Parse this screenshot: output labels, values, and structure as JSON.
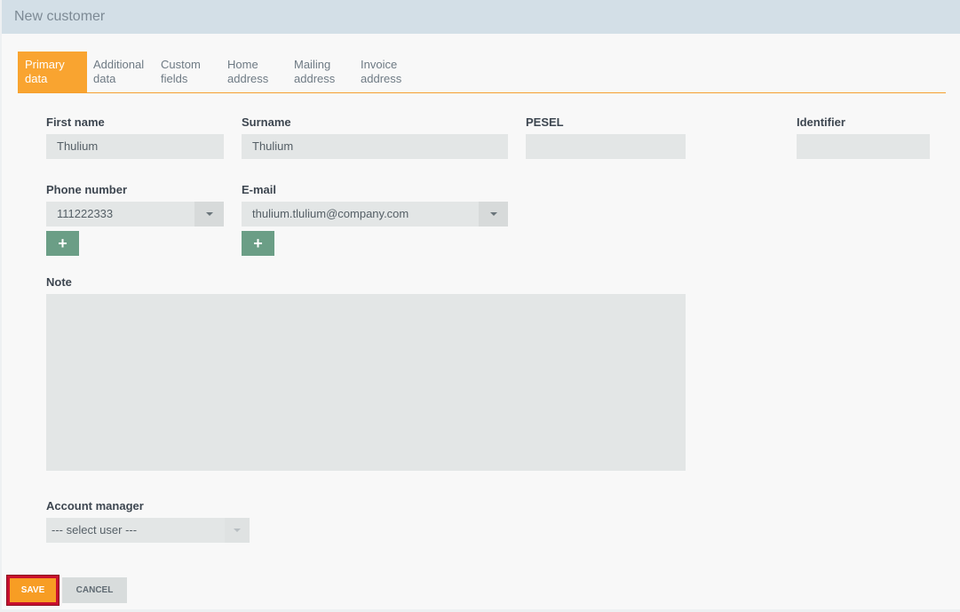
{
  "header": {
    "title": "New customer"
  },
  "tabs": [
    {
      "label": "Primary\ndata",
      "active": true
    },
    {
      "label": "Additional\ndata"
    },
    {
      "label": "Custom\nfields"
    },
    {
      "label": "Home\naddress"
    },
    {
      "label": "Mailing\naddress"
    },
    {
      "label": "Invoice\naddress"
    }
  ],
  "form": {
    "first_name": {
      "label": "First name",
      "value": "Thulium"
    },
    "surname": {
      "label": "Surname",
      "value": "Thulium"
    },
    "pesel": {
      "label": "PESEL",
      "value": ""
    },
    "identifier": {
      "label": "Identifier",
      "value": ""
    },
    "phone": {
      "label": "Phone number",
      "value": "111222333",
      "add_label": "+"
    },
    "email": {
      "label": "E-mail",
      "value": "thulium.tlulium@company.com",
      "add_label": "+"
    },
    "note": {
      "label": "Note",
      "value": ""
    },
    "account_manager": {
      "label": "Account manager",
      "placeholder": "--- select user ---"
    }
  },
  "buttons": {
    "save": "SAVE",
    "cancel": "CANCEL"
  },
  "colors": {
    "accent": "#f9a430",
    "add_button": "#6b9e86",
    "save_border": "#c8102e"
  }
}
